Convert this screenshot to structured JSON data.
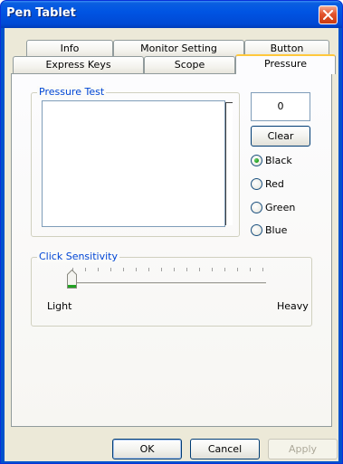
{
  "window": {
    "title": "Pen Tablet"
  },
  "tabs": {
    "row1": [
      "Info",
      "Monitor Setting",
      "Button"
    ],
    "row2": [
      "Express Keys",
      "Scope",
      "Pressure"
    ],
    "active": "Pressure"
  },
  "pressure_test": {
    "label": "Pressure Test",
    "value": "0",
    "clear_label": "Clear",
    "colors": [
      {
        "label": "Black",
        "selected": true
      },
      {
        "label": "Red",
        "selected": false
      },
      {
        "label": "Green",
        "selected": false
      },
      {
        "label": "Blue",
        "selected": false
      }
    ]
  },
  "click_sensitivity": {
    "label": "Click Sensitivity",
    "min_label": "Light",
    "max_label": "Heavy",
    "value_fraction": 0.0
  },
  "footer": {
    "ok_label": "OK",
    "cancel_label": "Cancel",
    "apply_label": "Apply"
  },
  "colors": {
    "title_bar": "#0054e3",
    "accent_tab": "#ffc83c",
    "group_label": "#0046d5",
    "radio_selected": "#21a121"
  }
}
